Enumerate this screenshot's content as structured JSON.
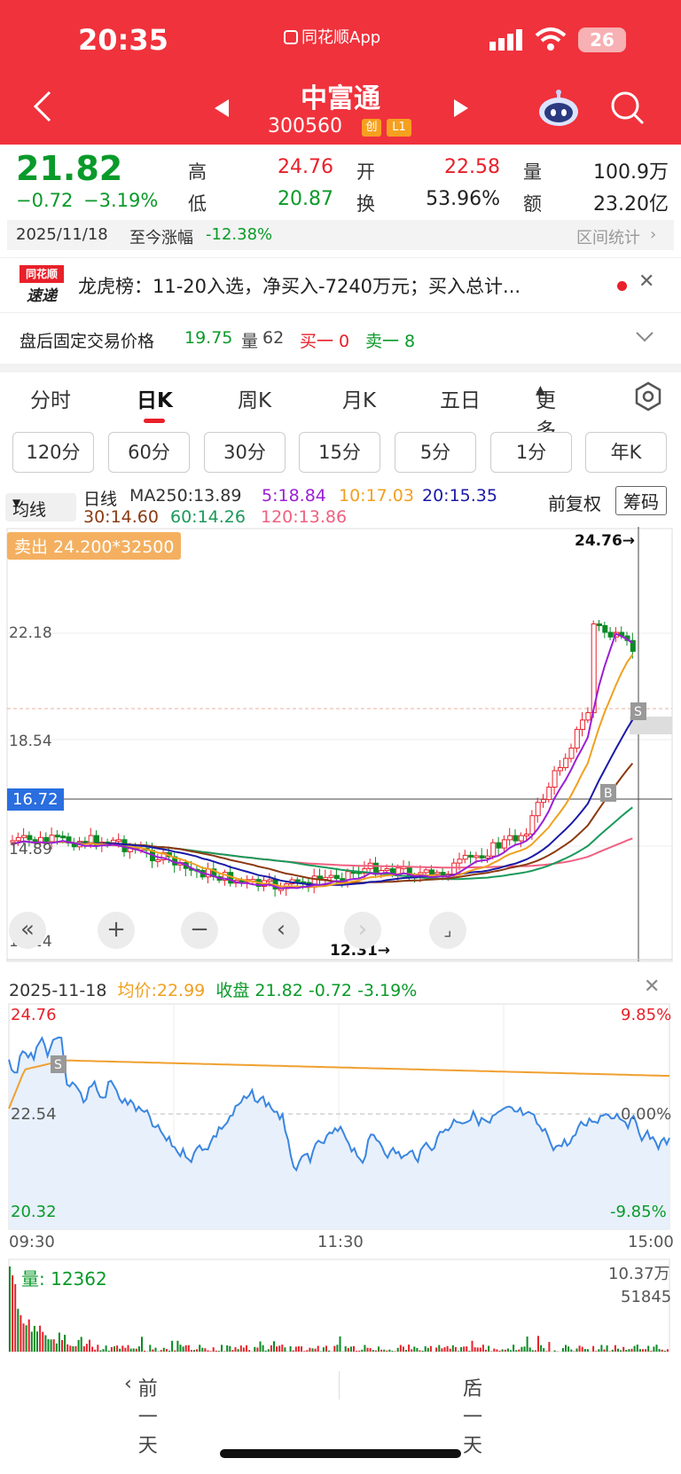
{
  "status": {
    "time": "20:35",
    "app_name": "同花顺App",
    "battery": "26"
  },
  "stock": {
    "name": "中富通",
    "code": "300560",
    "tag_chuang": "创",
    "tag_level": "L1"
  },
  "quote": {
    "price": "21.82",
    "change": "−0.72",
    "change_pct": "−3.19%",
    "high_label": "高",
    "high": "24.76",
    "low_label": "低",
    "low": "20.87",
    "open_label": "开",
    "open": "22.58",
    "turnover_label": "换",
    "turnover": "53.96%",
    "volume_label": "量",
    "volume": "100.9万",
    "amount_label": "额",
    "amount": "23.20亿",
    "date": "2025/11/18",
    "since_label": "至今涨幅",
    "since_value": "-12.38%",
    "range_stats": "区间统计"
  },
  "news": {
    "logo_top": "同花顺",
    "logo_bottom": "速递",
    "text": "龙虎榜：11-20入选，净买入-7240万元；买入总计..."
  },
  "after_hours": {
    "label": "盘后固定交易价格",
    "price": "19.75",
    "vol_label": "量",
    "vol": "62",
    "buy1": "买一 0",
    "sell1": "卖一 8"
  },
  "tabs": [
    "分时",
    "日K",
    "周K",
    "月K",
    "五日",
    "更多"
  ],
  "active_tab": "日K",
  "periods": [
    "120分",
    "60分",
    "30分",
    "15分",
    "5分",
    "1分",
    "年K"
  ],
  "kline": {
    "ma_select": "均线",
    "kind": "日线",
    "ma250": "MA250:13.89",
    "ma5": "5:18.84",
    "ma10": "10:17.03",
    "ma20": "20:15.35",
    "ma30": "30:14.60",
    "ma60": "60:14.26",
    "ma120": "120:13.86",
    "adjust": "前复权",
    "chips": "筹码",
    "sell_badge": "卖出 24.200*32500",
    "y_labels": [
      "22.18",
      "18.54",
      "14.89",
      "11.24"
    ],
    "crosshair_price": "16.72",
    "max_label": "24.76→",
    "min_label": "12.31→",
    "colors": {
      "ma5": "#9b1fd6",
      "ma10": "#f0a020",
      "ma20": "#1a1aa8",
      "ma30": "#8b3a10",
      "ma60": "#1a9a5a",
      "ma120": "#f06080"
    }
  },
  "intraday": {
    "date": "2025-11-18",
    "avg_label": "均价:",
    "avg": "22.99",
    "close_label": "收盘",
    "close": "21.82",
    "chg": "-0.72",
    "pct": "-3.19%",
    "y_high": "24.76",
    "y_mid": "22.54",
    "y_low": "20.32",
    "pct_high": "9.85%",
    "pct_mid": "0.00%",
    "pct_low": "-9.85%",
    "times": [
      "09:30",
      "11:30",
      "15:00"
    ],
    "vol_label": "量:",
    "vol": "12362",
    "vol_max": "10.37万",
    "vol_mid": "51845"
  },
  "footer": {
    "prev": "前一天",
    "next": "后一天"
  }
}
